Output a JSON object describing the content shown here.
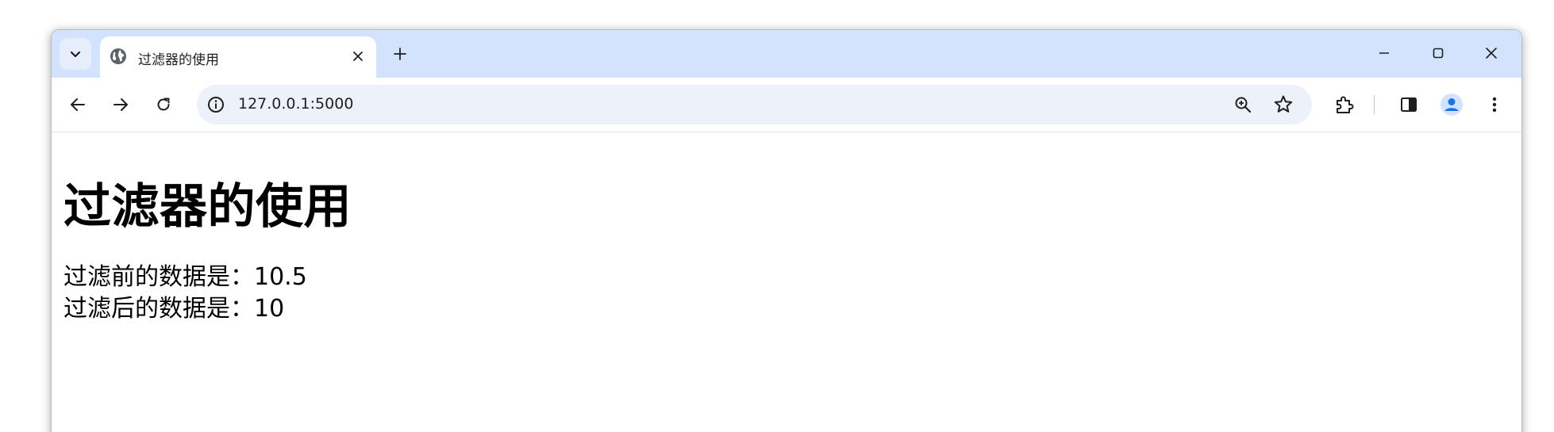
{
  "browser": {
    "tab": {
      "title": "过滤器的使用",
      "icon": "globe-icon"
    },
    "address_bar": {
      "url": "127.0.0.1:5000"
    },
    "colors": {
      "tabstrip": "#d3e3fd",
      "omnibox": "#edf2fa",
      "profile_accent": "#1a73e8"
    }
  },
  "page": {
    "heading": "过滤器的使用",
    "before_line": "过滤前的数据是：10.5",
    "after_line": "过滤后的数据是：10"
  }
}
